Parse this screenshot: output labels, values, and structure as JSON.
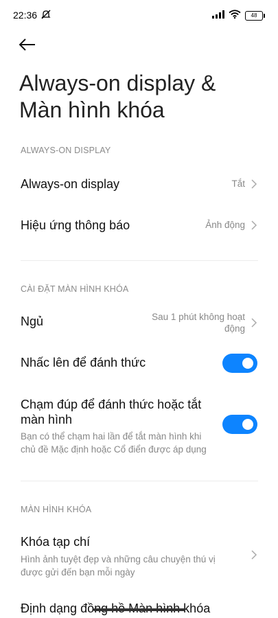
{
  "status": {
    "time": "22:36",
    "battery": "48"
  },
  "page": {
    "title_line1": "Always-on display &",
    "title_line2": "Màn hình khóa"
  },
  "sections": {
    "aod": {
      "header": "ALWAYS-ON DISPLAY",
      "items": [
        {
          "title": "Always-on display",
          "value": "Tắt"
        },
        {
          "title": "Hiệu ứng thông báo",
          "value": "Ảnh động"
        }
      ]
    },
    "lock_settings": {
      "header": "CÀI ĐẶT MÀN HÌNH KHÓA",
      "sleep": {
        "title": "Ngủ",
        "value_line1": "Sau 1 phút không hoạt",
        "value_line2": "động"
      },
      "raise_to_wake": {
        "title": "Nhấc lên để đánh thức",
        "enabled": true
      },
      "double_tap": {
        "title_line1": "Chạm đúp để đánh thức hoặc tắt",
        "title_line2": "màn hình",
        "sub_line1": "Bạn có thể chạm hai lần để tắt màn hình khi",
        "sub_line2": "chủ đề Mặc định hoặc Cổ điển được áp dụng",
        "enabled": true
      }
    },
    "lock_screen": {
      "header": "MÀN HÌNH KHÓA",
      "magazine": {
        "title": "Khóa tạp chí",
        "sub_line1": "Hình ảnh tuyệt đẹp và những câu chuyện thú vị",
        "sub_line2": "được gửi đến bạn mỗi ngày"
      },
      "clock_format": {
        "title": "Định dạng đồng hồ Màn hình khóa"
      }
    }
  },
  "colors": {
    "accent": "#0d84ff",
    "secondary_text": "#888888",
    "header_text": "#8a8a8a"
  },
  "icons": [
    "mute-icon",
    "signal-icon",
    "wifi-icon",
    "battery-icon",
    "back-arrow-icon",
    "chevron-right-icon"
  ]
}
